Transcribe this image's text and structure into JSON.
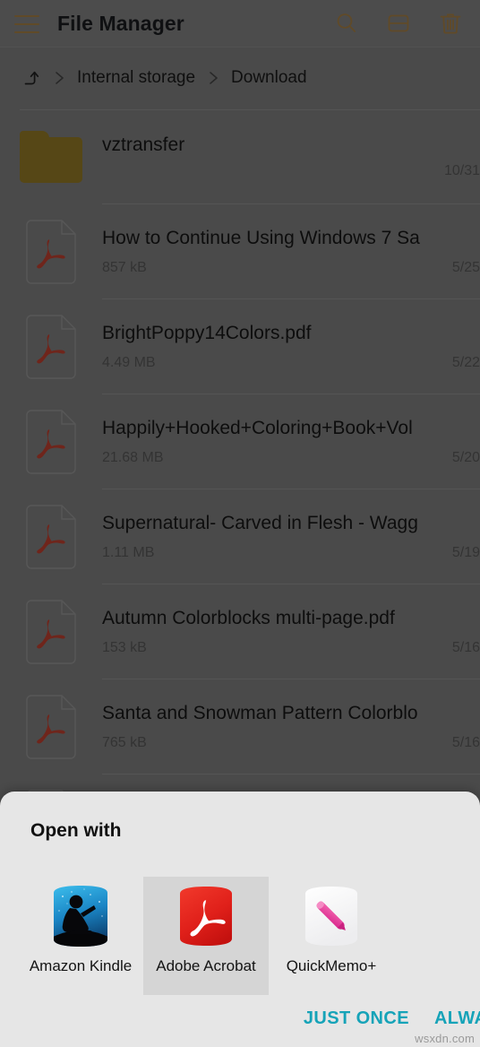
{
  "colors": {
    "toolbar_icon": "#8a6a3a",
    "folder": "#7b6620",
    "pdf_red": "#a03528",
    "accent": "#16a3b8",
    "sheet_bg": "#e6e6e6",
    "selected_bg": "#d5d5d5",
    "acrobat_red": "#e02b20",
    "quickmemo_pink": "#e0449b",
    "kindle_blue": "#2ea8e0"
  },
  "toolbar": {
    "menu_icon": "hamburger-menu-icon",
    "title": "File Manager",
    "actions": [
      {
        "name": "search-icon",
        "label": "Search"
      },
      {
        "name": "split-view-icon",
        "label": "Split view"
      },
      {
        "name": "trash-icon",
        "label": "Delete"
      }
    ]
  },
  "breadcrumb": {
    "up_icon": "arrow-up-icon",
    "separator": "chevron-right-icon",
    "items": [
      {
        "label": "Internal storage"
      },
      {
        "label": "Download"
      }
    ]
  },
  "file_list": [
    {
      "type": "folder",
      "icon": "folder-icon",
      "name": "vztransfer",
      "size": "",
      "date": "10/31"
    },
    {
      "type": "pdf",
      "icon": "pdf-file-icon",
      "name": "How to Continue Using Windows 7 Sa",
      "size": "857 kB",
      "date": "5/25"
    },
    {
      "type": "pdf",
      "icon": "pdf-file-icon",
      "name": "BrightPoppy14Colors.pdf",
      "size": "4.49 MB",
      "date": "5/22"
    },
    {
      "type": "pdf",
      "icon": "pdf-file-icon",
      "name": "Happily+Hooked+Coloring+Book+Vol",
      "size": "21.68 MB",
      "date": "5/20"
    },
    {
      "type": "pdf",
      "icon": "pdf-file-icon",
      "name": "Supernatural- Carved in Flesh - Wagg",
      "size": "1.11 MB",
      "date": "5/19"
    },
    {
      "type": "pdf",
      "icon": "pdf-file-icon",
      "name": "Autumn Colorblocks multi-page.pdf",
      "size": "153 kB",
      "date": "5/16"
    },
    {
      "type": "pdf",
      "icon": "pdf-file-icon",
      "name": "Santa and Snowman Pattern Colorblo",
      "size": "765 kB",
      "date": "5/16"
    }
  ],
  "open_with_sheet": {
    "title": "Open with",
    "apps": [
      {
        "label": "Amazon Kindle",
        "icon": "amazon-kindle-icon",
        "selected": false
      },
      {
        "label": "Adobe Acrobat",
        "icon": "adobe-acrobat-icon",
        "selected": true
      },
      {
        "label": "QuickMemo+",
        "icon": "quickmemo-plus-icon",
        "selected": false
      }
    ],
    "just_once_label": "JUST ONCE",
    "always_label": "ALWAYS"
  },
  "watermark": "wsxdn.com"
}
